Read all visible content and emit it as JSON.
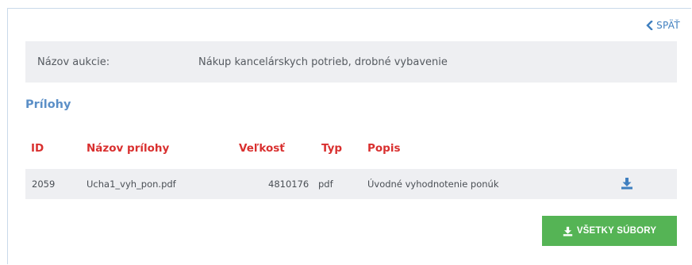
{
  "nav": {
    "back_label": "SPÄŤ"
  },
  "auction": {
    "label": "Názov aukcie:",
    "value": "Nákup kancelárskych potrieb, drobné vybavenie"
  },
  "attachments": {
    "title": "Prílohy",
    "columns": [
      "ID",
      "Názov prílohy",
      "Veľkosť",
      "Typ",
      "Popis"
    ],
    "rows": [
      {
        "id": "2059",
        "name": "Ucha1_vyh_pon.pdf",
        "size": "4810176",
        "type": "pdf",
        "description": "Úvodné vyhodnotenie ponúk",
        "download_icon": "download-icon"
      }
    ]
  },
  "actions": {
    "all_files_label": "VŠETKY SÚBORY",
    "all_files_icon": "download-icon"
  },
  "colors": {
    "link": "#3f7fbf",
    "section_title": "#5b8fc7",
    "table_header": "#d9302f",
    "button_bg": "#55b455",
    "panel_bg": "#eeeff2"
  }
}
